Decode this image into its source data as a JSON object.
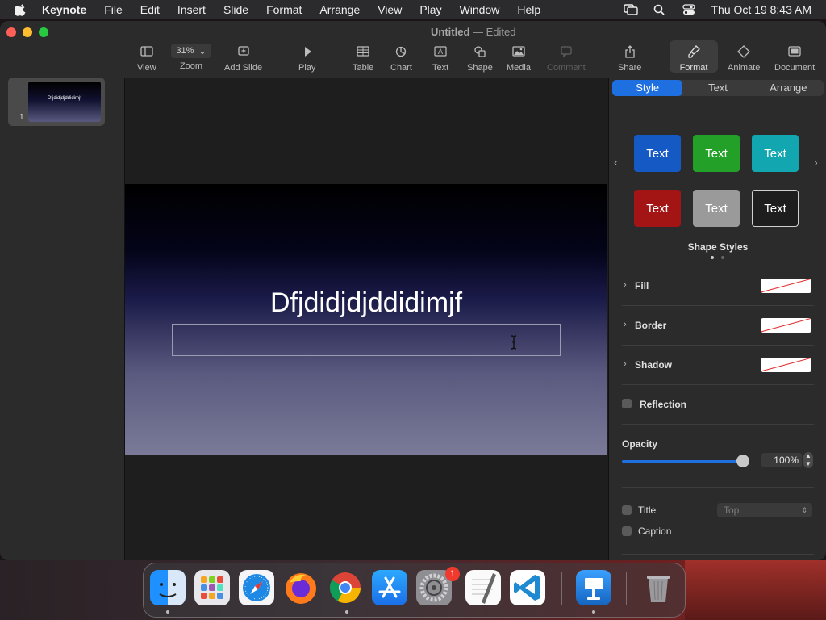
{
  "menubar": {
    "app_name": "Keynote",
    "items": [
      "File",
      "Edit",
      "Insert",
      "Slide",
      "Format",
      "Arrange",
      "View",
      "Play",
      "Window",
      "Help"
    ],
    "datetime": "Thu Oct 19  8:43 AM"
  },
  "window": {
    "title": "Untitled",
    "separator": "—",
    "status": "Edited"
  },
  "toolbar": {
    "view_label": "View",
    "zoom_value": "31%",
    "zoom_label": "Zoom",
    "add_slide_label": "Add Slide",
    "play_label": "Play",
    "table_label": "Table",
    "chart_label": "Chart",
    "text_label": "Text",
    "shape_label": "Shape",
    "media_label": "Media",
    "comment_label": "Comment",
    "share_label": "Share",
    "format_label": "Format",
    "animate_label": "Animate",
    "document_label": "Document"
  },
  "navigator": {
    "slide_number": "1",
    "slide_title": "Dfjdidjdjddidimjf"
  },
  "slide": {
    "title": "Dfjdidjdjddidimjf",
    "subtitle": ""
  },
  "inspector": {
    "tabs": [
      "Style",
      "Text",
      "Arrange"
    ],
    "active_tab": "Style",
    "style_buttons": [
      {
        "label": "Text",
        "color": "#1559c4"
      },
      {
        "label": "Text",
        "color": "#23a027"
      },
      {
        "label": "Text",
        "color": "#12a6b0"
      },
      {
        "label": "Text",
        "color": "#a31515"
      },
      {
        "label": "Text",
        "color": "#9a9a9a"
      },
      {
        "label": "Text",
        "color": "#1e1e1e"
      }
    ],
    "shape_styles_label": "Shape Styles",
    "fill_label": "Fill",
    "border_label": "Border",
    "shadow_label": "Shadow",
    "reflection_label": "Reflection",
    "opacity_label": "Opacity",
    "opacity_value": "100%",
    "opacity_level": 1.0,
    "title_label": "Title",
    "title_position": "Top",
    "caption_label": "Caption"
  },
  "dock": {
    "apps": [
      "finder-icon",
      "launchpad-icon",
      "safari-icon",
      "firefox-icon",
      "chrome-icon",
      "app-store-icon",
      "system-settings-icon",
      "textedit-icon",
      "vscode-icon",
      "keynote-icon",
      "trash-icon"
    ],
    "settings_badge": "1"
  }
}
